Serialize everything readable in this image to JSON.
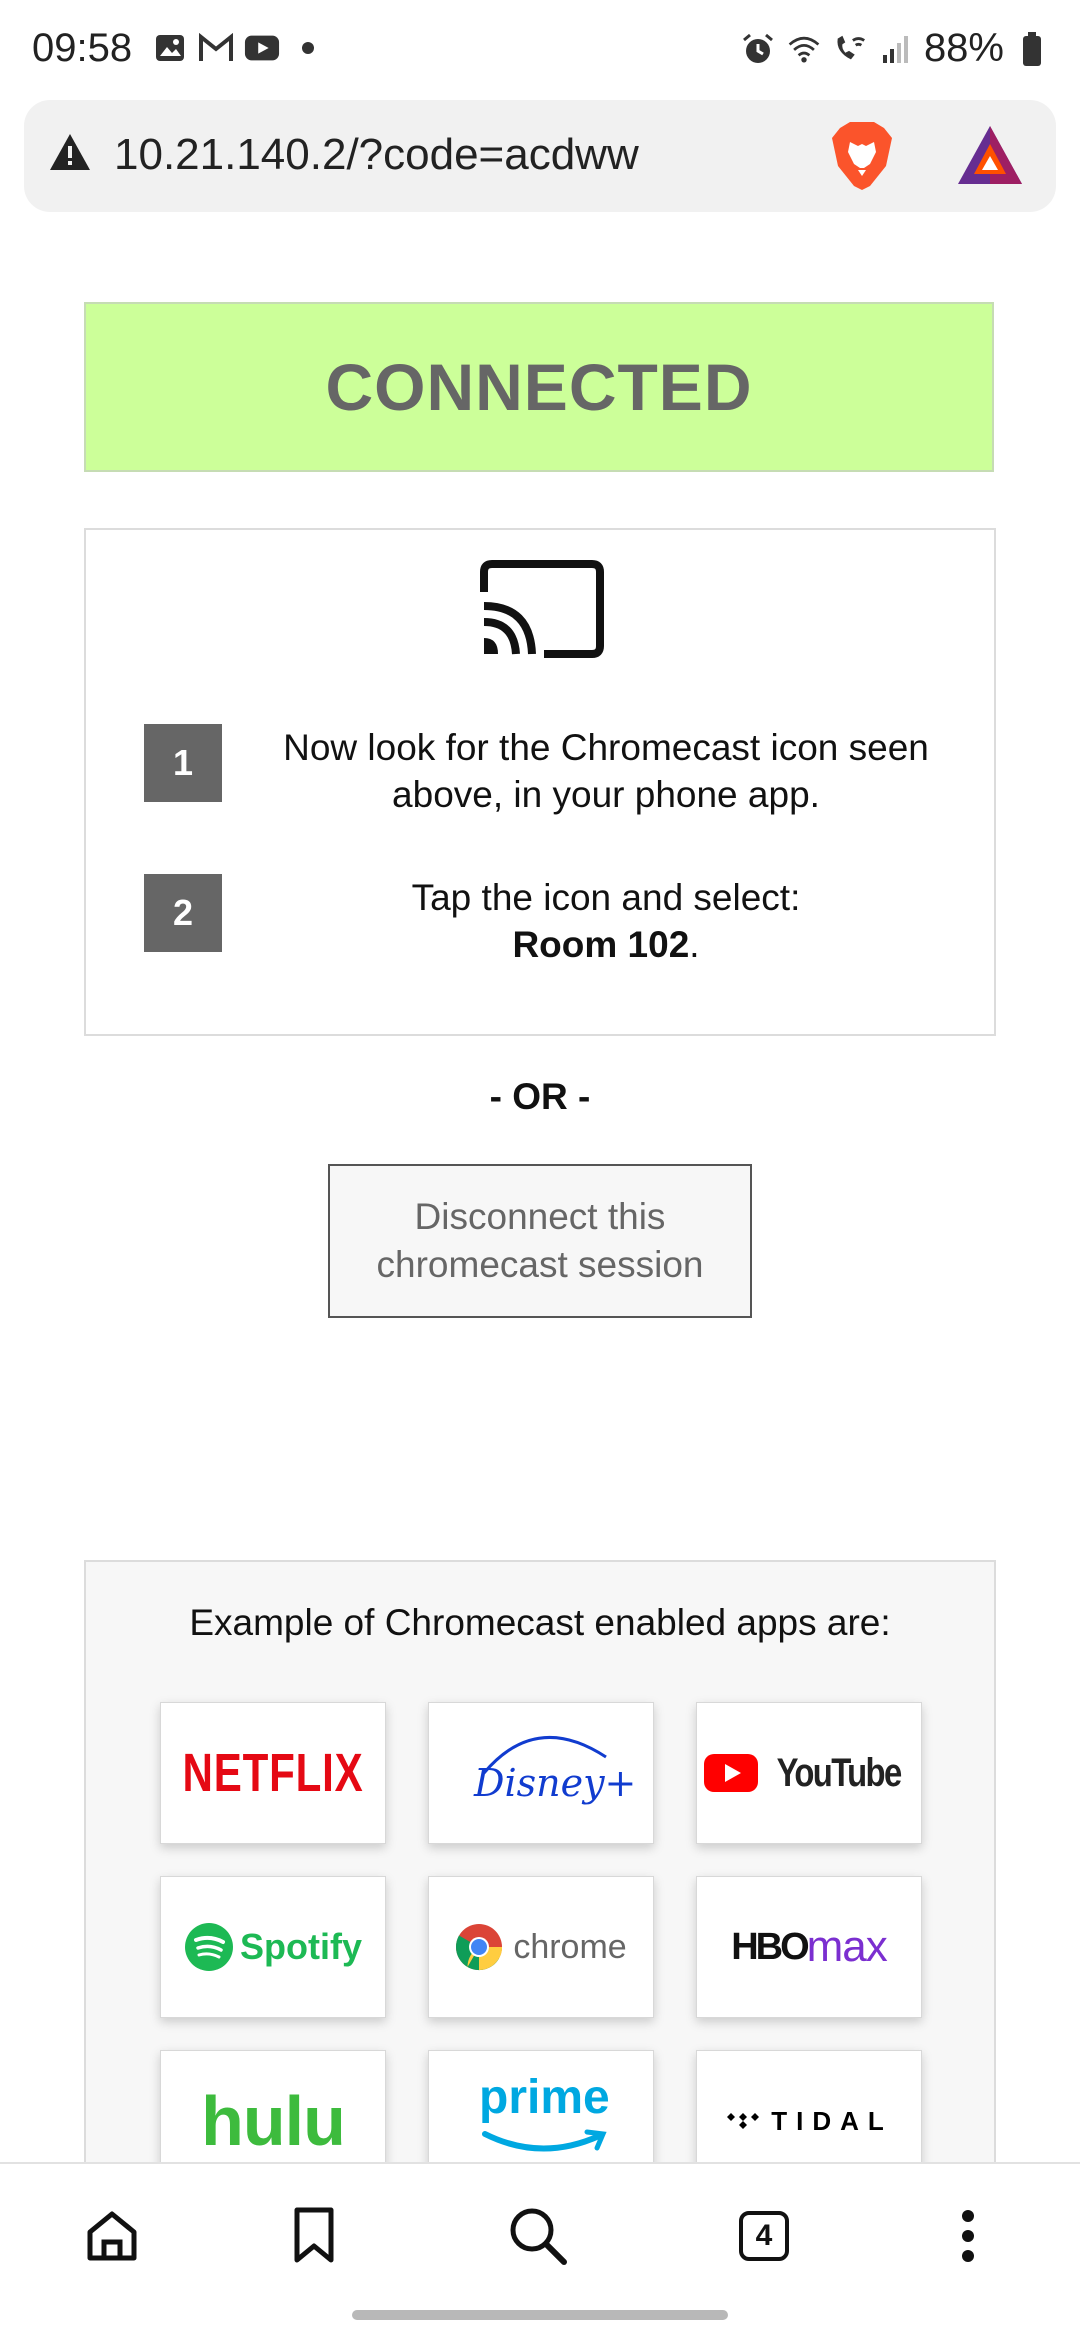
{
  "status_bar": {
    "time": "09:58",
    "battery": "88%",
    "left_icons": [
      "gallery-icon",
      "gmail-icon",
      "youtube-icon",
      "dot-icon"
    ],
    "right_icons": [
      "alarm-icon",
      "wifi-icon",
      "wifi-call-icon",
      "signal-icon",
      "battery-icon"
    ]
  },
  "browser": {
    "url": "10.21.140.2/?code=acdww",
    "security_icon": "warning-icon",
    "extension_icons": [
      "brave-lion-icon",
      "bat-triangle-icon"
    ]
  },
  "banner": {
    "status": "CONNECTED",
    "color": "#ccff99"
  },
  "instructions": {
    "cast_icon": "chromecast-icon",
    "steps": [
      {
        "number": "1",
        "text": "Now look for the Chromecast icon seen above, in your phone app."
      },
      {
        "number": "2",
        "text_prefix": "Tap the icon and select:",
        "room": "Room 102",
        "suffix": "."
      }
    ]
  },
  "or_label": "- OR -",
  "disconnect_button": "Disconnect this chromecast session",
  "apps": {
    "title": "Example of Chromecast enabled apps are:",
    "items": [
      {
        "name": "NETFLIX",
        "color": "#e50914"
      },
      {
        "name": "Disney+",
        "color": "#113ccf"
      },
      {
        "name": "YouTube",
        "color": "#ff0000"
      },
      {
        "name": "Spotify",
        "color": "#1db954"
      },
      {
        "name": "chrome",
        "color": "#666666"
      },
      {
        "name": "HBO",
        "name2": "max",
        "color": "#7b2fd0"
      },
      {
        "name": "hulu",
        "color": "#3dbb3d"
      },
      {
        "name": "prime",
        "color": "#00a8e1"
      },
      {
        "name": "TIDAL",
        "color": "#000000"
      }
    ]
  },
  "bottom_nav": {
    "tabs_count": "4",
    "items": [
      "home-icon",
      "bookmark-icon",
      "search-icon",
      "tabs-icon",
      "more-icon"
    ]
  }
}
